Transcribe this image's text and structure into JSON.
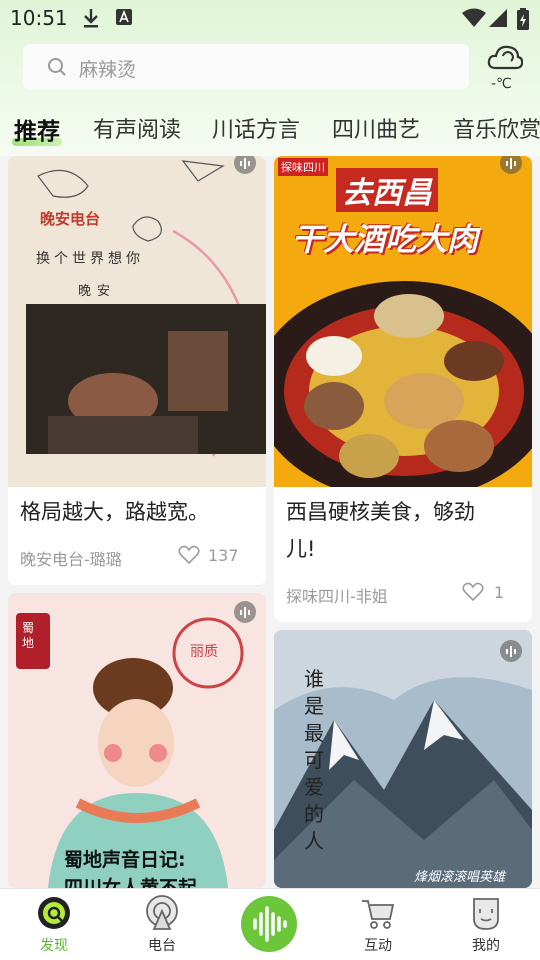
{
  "status_bar": {
    "time": "10:51"
  },
  "search": {
    "placeholder": "麻辣烫"
  },
  "weather": {
    "temp": "-℃"
  },
  "tabs": [
    {
      "label": "推荐",
      "active": true
    },
    {
      "label": "有声阅读"
    },
    {
      "label": "川话方言"
    },
    {
      "label": "四川曲艺"
    },
    {
      "label": "音乐欣赏"
    }
  ],
  "cards": [
    {
      "title": "格局越大，路越宽。",
      "author": "晚安电台-璐璐",
      "likes": "137",
      "image_text": {
        "line1": "晚安电台",
        "line2": "换个世界想你",
        "line3": "晚安"
      }
    },
    {
      "title_line1": "西昌硬核美食，够劲",
      "title_line2": "儿!",
      "author": "探味四川-非姐",
      "likes": "1",
      "image_text": {
        "line1": "去西昌",
        "line2": "干大酒吃大肉",
        "stamp": "探味四川"
      }
    },
    {
      "image_text": {
        "stamp": "蜀地",
        "seal": "丽质",
        "line1": "蜀地声音日记:",
        "line2": "四川女人黄不起"
      }
    },
    {
      "image_text": {
        "vertical": "谁是最可爱的人",
        "caption": "烽烟滚滚唱英雄"
      }
    }
  ],
  "bottom_nav": [
    {
      "label": "发现",
      "icon": "discover-icon",
      "active": true
    },
    {
      "label": "电台",
      "icon": "radio-icon"
    },
    {
      "label": "互动",
      "icon": "cart-icon"
    },
    {
      "label": "我的",
      "icon": "profile-icon"
    }
  ],
  "colors": {
    "accent": "#6cc63a",
    "active_label": "#5cb82f"
  }
}
